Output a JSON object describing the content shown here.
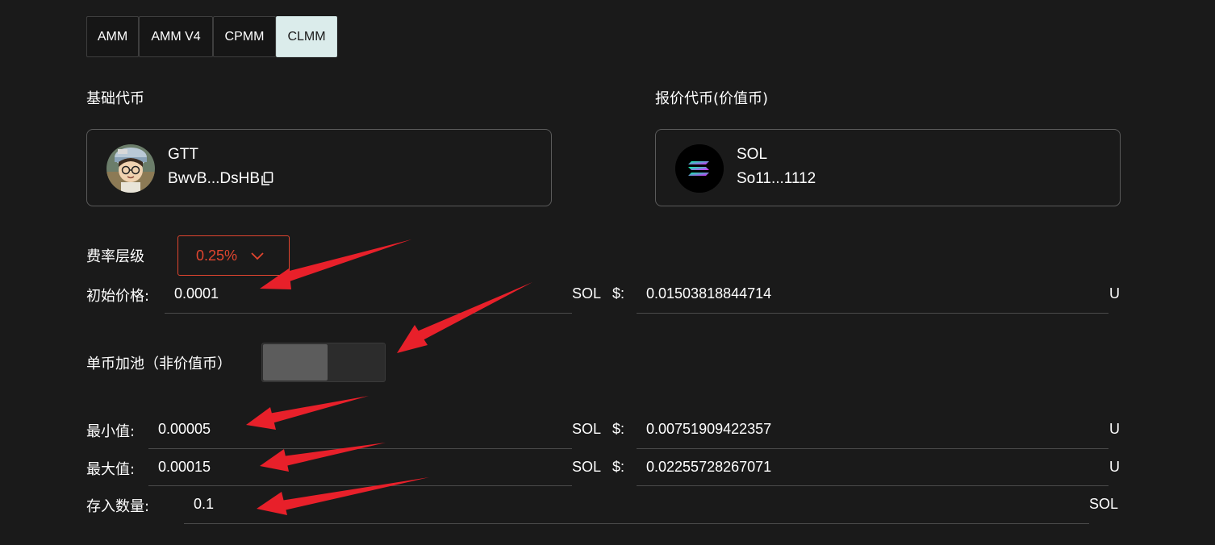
{
  "tabs": [
    {
      "label": "AMM"
    },
    {
      "label": "AMM V4"
    },
    {
      "label": "CPMM"
    },
    {
      "label": "CLMM",
      "active": true
    }
  ],
  "base_token": {
    "label": "基础代币",
    "symbol": "GTT",
    "address": "BwvB...DsHB",
    "icon": "avatar-cartoon-boy"
  },
  "quote_token": {
    "label": "报价代币(价值币)",
    "symbol": "SOL",
    "address": "So11...1112",
    "icon": "solana-logo"
  },
  "fee_tier": {
    "label": "费率层级",
    "value": "0.25%",
    "color": "#e0452f"
  },
  "initial_price": {
    "label": "初始价格:",
    "value": "0.0001",
    "currency": "SOL",
    "usd_label": "$:",
    "usd_value": "0.01503818844714",
    "unit": "U"
  },
  "single_side": {
    "label": "单币加池（非价值币）",
    "enabled": false
  },
  "min_price": {
    "label": "最小值:",
    "value": "0.00005",
    "currency": "SOL",
    "usd_label": "$:",
    "usd_value": "0.00751909422357",
    "unit": "U"
  },
  "max_price": {
    "label": "最大值:",
    "value": "0.00015",
    "currency": "SOL",
    "usd_label": "$:",
    "usd_value": "0.02255728267071",
    "unit": "U"
  },
  "deposit": {
    "label": "存入数量:",
    "value": "0.1",
    "unit": "SOL"
  },
  "colors": {
    "background": "#1a1a1a",
    "accent": "#e0452f",
    "active_tab": "#dbeceb",
    "annotation_arrow": "#e8202a"
  }
}
